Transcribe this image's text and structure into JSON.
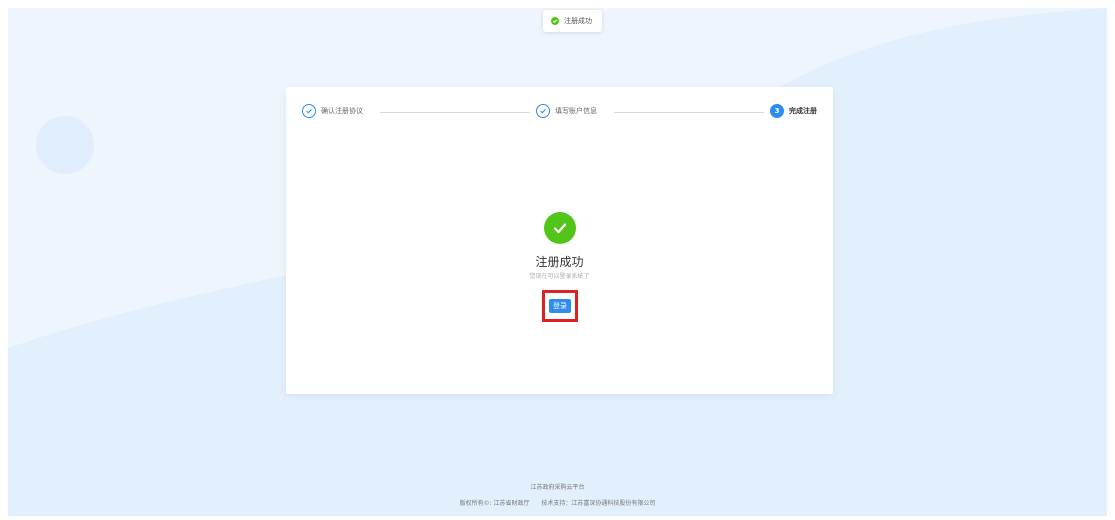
{
  "toast": {
    "text": "注册成功"
  },
  "steps": [
    {
      "label": "确认注册协议",
      "status": "done"
    },
    {
      "label": "填写账户信息",
      "status": "done"
    },
    {
      "label": "完成注册",
      "status": "current",
      "number": "3"
    }
  ],
  "result": {
    "title": "注册成功",
    "subtitle": "您现在可以登录系统了",
    "login_label": "登录"
  },
  "footer": {
    "platform": "江苏政府采购云平台",
    "copyright": "版权所有©: 江苏省财政厅",
    "support": "技术支持：江苏富深协通科技股份有限公司"
  },
  "colors": {
    "primary": "#2d8cf0",
    "success": "#52c41a",
    "highlight": "#e02020",
    "background": "#eef5fd"
  },
  "icons": [
    "check-circle-icon",
    "success-check-icon"
  ]
}
